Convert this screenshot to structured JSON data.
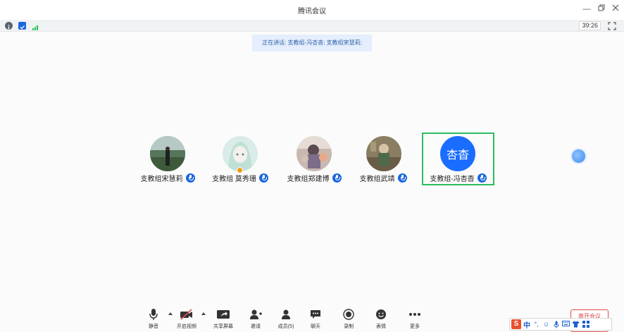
{
  "window": {
    "title": "腾讯会议"
  },
  "infobar": {
    "timer": "39:26"
  },
  "speaking_banner": "正在讲话: 支教组-冯杏杳; 支教组宋慧莉;",
  "participants": [
    {
      "name": "支教组宋慧莉",
      "avatar": "photo"
    },
    {
      "name": "支教组 莫秀珊",
      "avatar": "photo"
    },
    {
      "name": "支教组郑建博",
      "avatar": "photo"
    },
    {
      "name": "支教组武靖",
      "avatar": "photo"
    },
    {
      "name": "支教组-冯杏杳",
      "avatar_text": "杏杳",
      "active": true
    }
  ],
  "toolbar": {
    "items": [
      {
        "label": "静音",
        "icon": "mic-icon"
      },
      {
        "label": "开启视频",
        "icon": "camera-off-icon"
      },
      {
        "label": "共享屏幕",
        "icon": "share-screen-icon"
      },
      {
        "label": "邀请",
        "icon": "invite-icon"
      },
      {
        "label": "成员(5)",
        "icon": "members-icon"
      },
      {
        "label": "聊天",
        "icon": "chat-icon"
      },
      {
        "label": "录制",
        "icon": "record-icon"
      },
      {
        "label": "表情",
        "icon": "emoji-icon"
      },
      {
        "label": "更多",
        "icon": "more-icon"
      }
    ],
    "leave_label": "离开会议"
  },
  "ime": {
    "logo": "S",
    "mode": "中"
  },
  "colors": {
    "accent": "#1a66e0",
    "active_border": "#2bbd5e",
    "leave": "#e04a4a"
  }
}
